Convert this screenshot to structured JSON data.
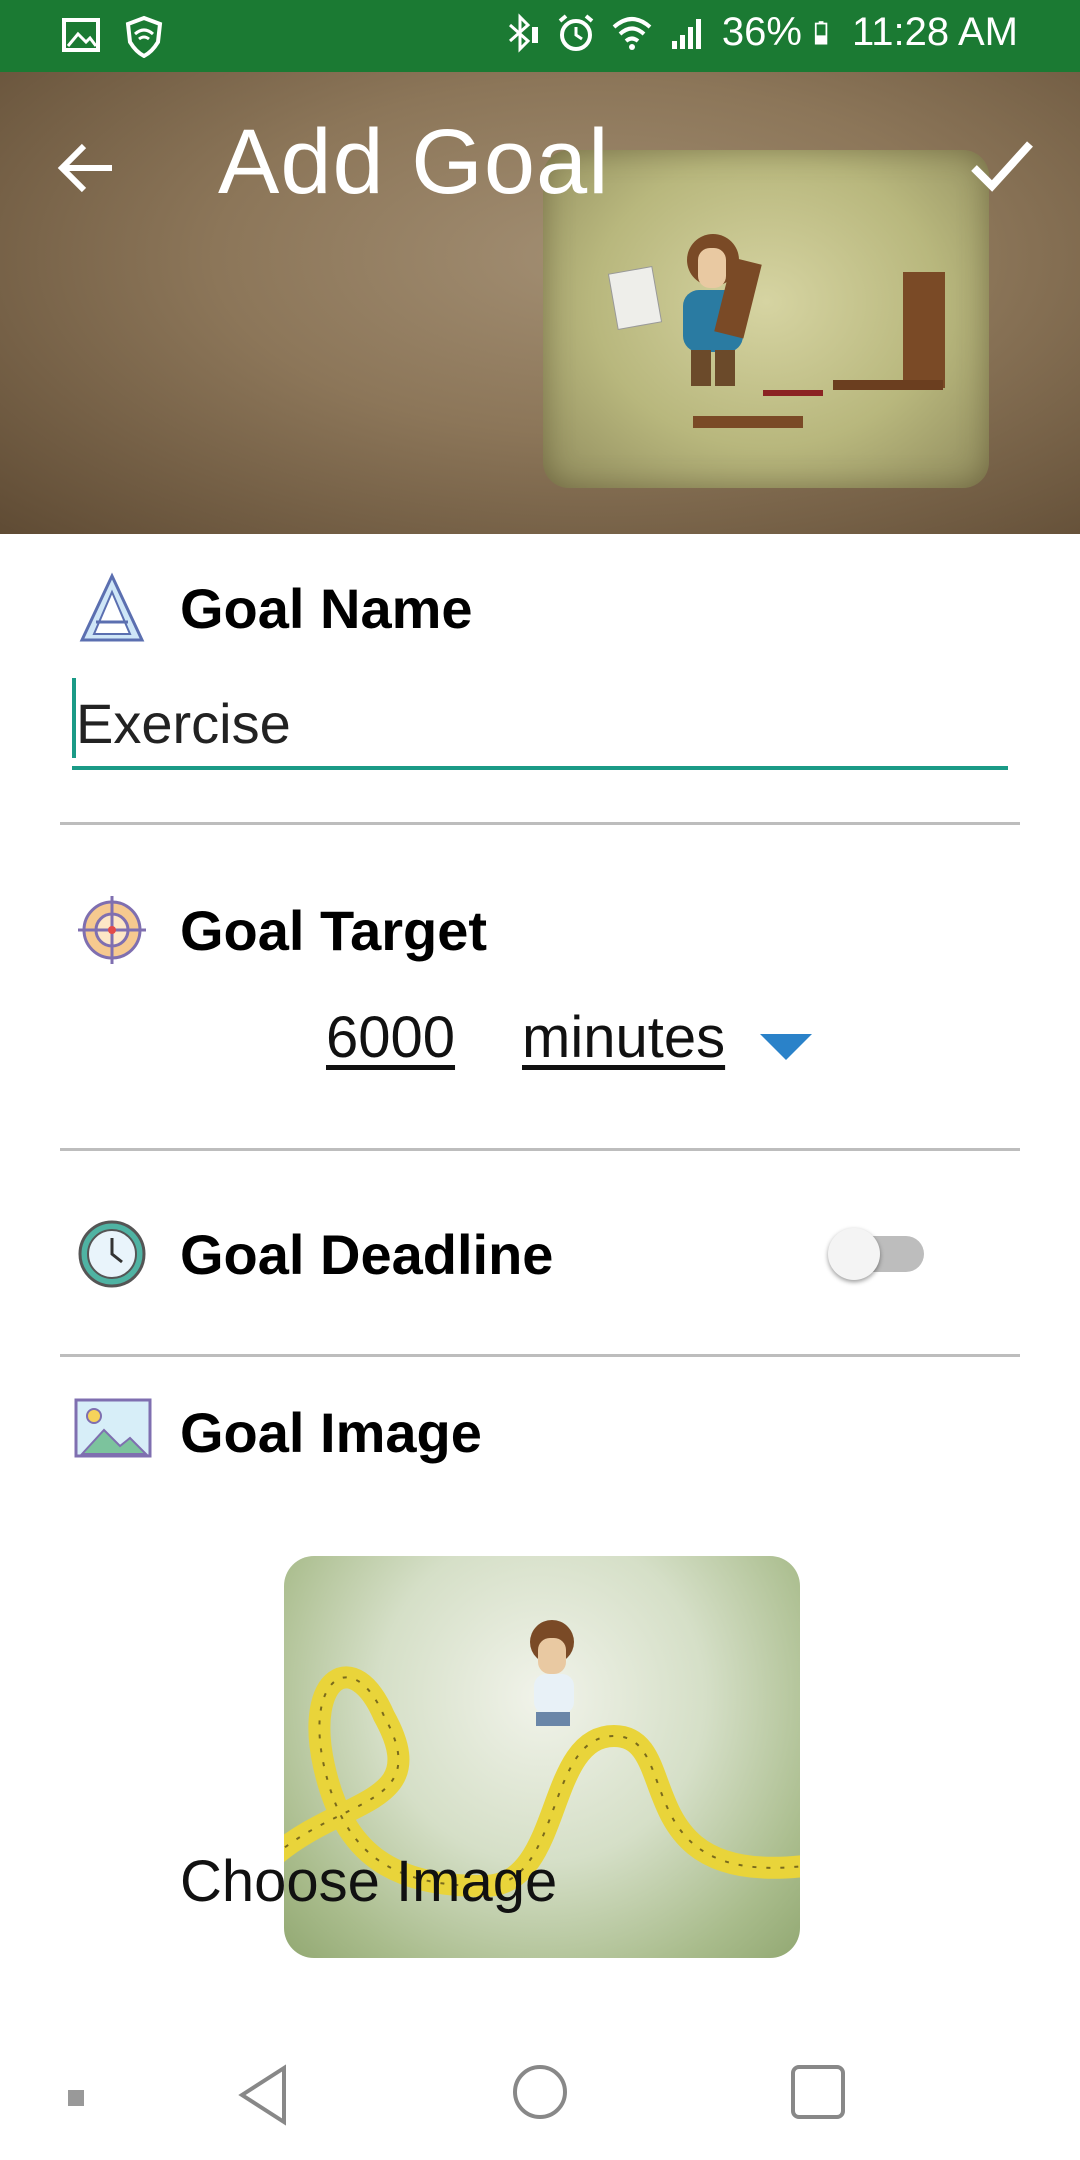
{
  "status_bar": {
    "battery": "36%",
    "time": "11:28 AM",
    "bg_color": "#1b7a33"
  },
  "header": {
    "title": "Add Goal",
    "back_icon": "arrow-left-icon",
    "confirm_icon": "check-icon"
  },
  "goal_name": {
    "label": "Goal Name",
    "value": "Exercise",
    "accent_color": "#1a9a86"
  },
  "goal_target": {
    "label": "Goal Target",
    "amount": "6000",
    "unit": "minutes"
  },
  "goal_deadline": {
    "label": "Goal Deadline",
    "enabled": false
  },
  "goal_image": {
    "label": "Goal Image",
    "choose_label": "Choose Image"
  },
  "nav": {
    "back": "triangle-back-icon",
    "home": "circle-home-icon",
    "recents": "square-recents-icon"
  }
}
